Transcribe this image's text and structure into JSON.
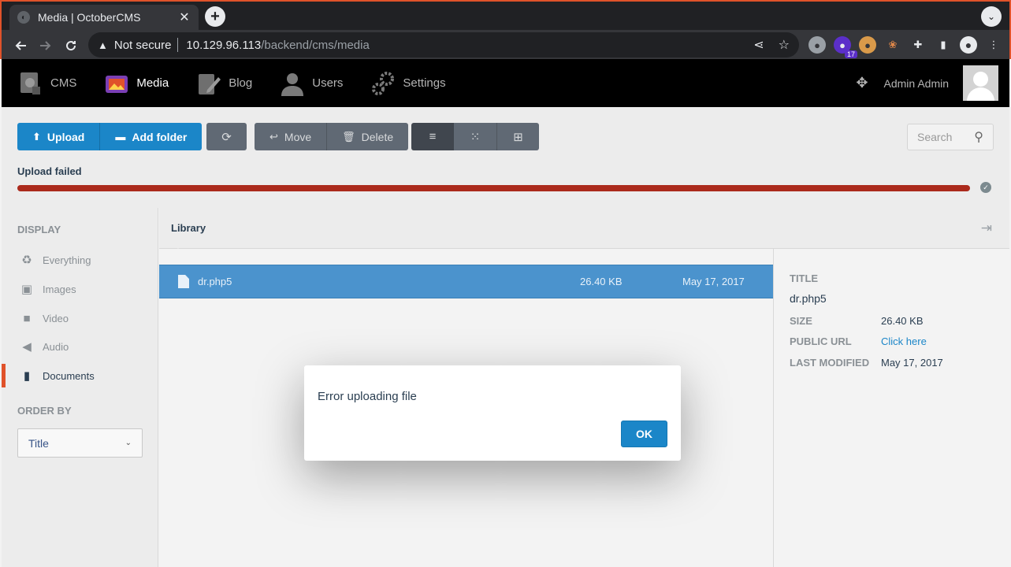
{
  "browser": {
    "tab_title": "Media | OctoberCMS",
    "tab_close": "✕",
    "new_tab": "+",
    "tab_menu": "⌄",
    "security_label": "Not secure",
    "url_host": "10.129.96.113",
    "url_path": "/backend/cms/media",
    "extension_badge": "17"
  },
  "nav": {
    "items": [
      {
        "label": "CMS",
        "icon": "cms-icon"
      },
      {
        "label": "Media",
        "icon": "media-icon"
      },
      {
        "label": "Blog",
        "icon": "blog-icon"
      },
      {
        "label": "Users",
        "icon": "users-icon"
      },
      {
        "label": "Settings",
        "icon": "settings-icon"
      }
    ],
    "user_name": "Admin Admin"
  },
  "toolbar": {
    "upload": "Upload",
    "add_folder": "Add folder",
    "move": "Move",
    "delete": "Delete",
    "search_placeholder": "Search",
    "upload_status": "Upload failed"
  },
  "sidebar": {
    "display_heading": "DISPLAY",
    "items": [
      {
        "label": "Everything",
        "icon": "recycle-icon"
      },
      {
        "label": "Images",
        "icon": "image-icon"
      },
      {
        "label": "Video",
        "icon": "video-icon"
      },
      {
        "label": "Audio",
        "icon": "audio-icon"
      },
      {
        "label": "Documents",
        "icon": "document-icon"
      }
    ],
    "order_heading": "ORDER BY",
    "order_value": "Title"
  },
  "library": {
    "title": "Library",
    "files": [
      {
        "name": "dr.php5",
        "size": "26.40 KB",
        "modified": "May 17, 2017"
      }
    ]
  },
  "details": {
    "title_label": "TITLE",
    "title_value": "dr.php5",
    "size_label": "SIZE",
    "size_value": "26.40 KB",
    "url_label": "PUBLIC URL",
    "url_value": "Click here",
    "modified_label": "LAST MODIFIED",
    "modified_value": "May 17, 2017"
  },
  "modal": {
    "message": "Error uploading file",
    "ok": "OK"
  },
  "colors": {
    "primary": "#1b86c8",
    "error": "#ab2a1c",
    "selected_row": "#4b93cd",
    "accent": "#e0522a"
  }
}
